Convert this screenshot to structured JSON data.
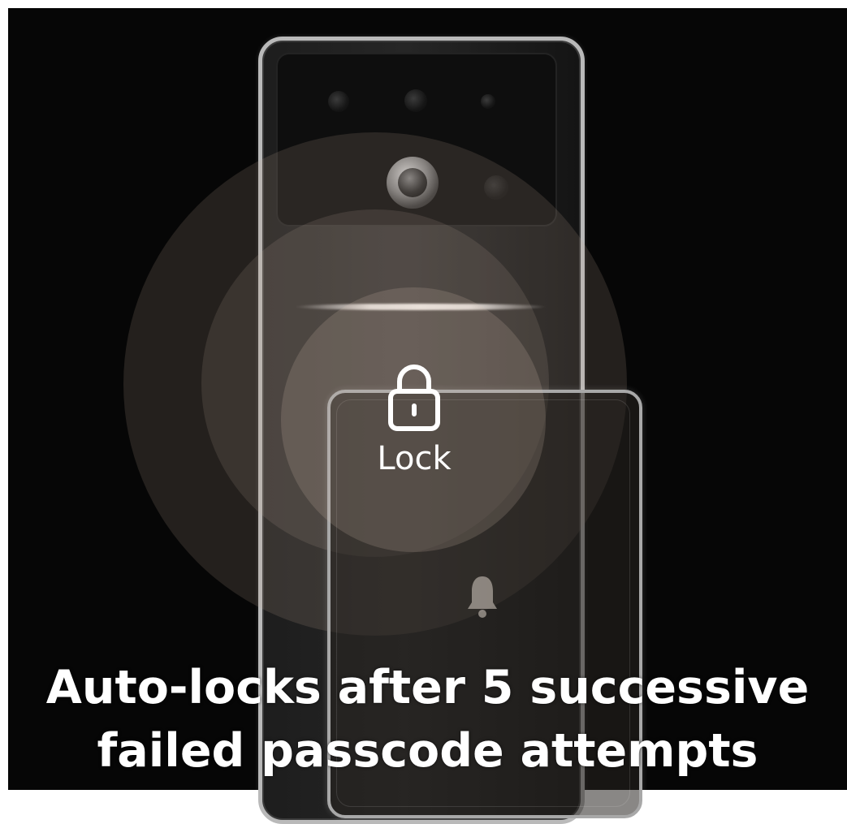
{
  "lock_label": "Lock",
  "headline": {
    "line1": "Auto-locks after 5 successive",
    "line2": "failed passcode attempts"
  },
  "icons": [
    "lock-icon",
    "bell-icon",
    "camera-lens-icon"
  ],
  "colors": {
    "background": "#060606",
    "text": "#ffffff",
    "glow": "#c8b4a0"
  }
}
